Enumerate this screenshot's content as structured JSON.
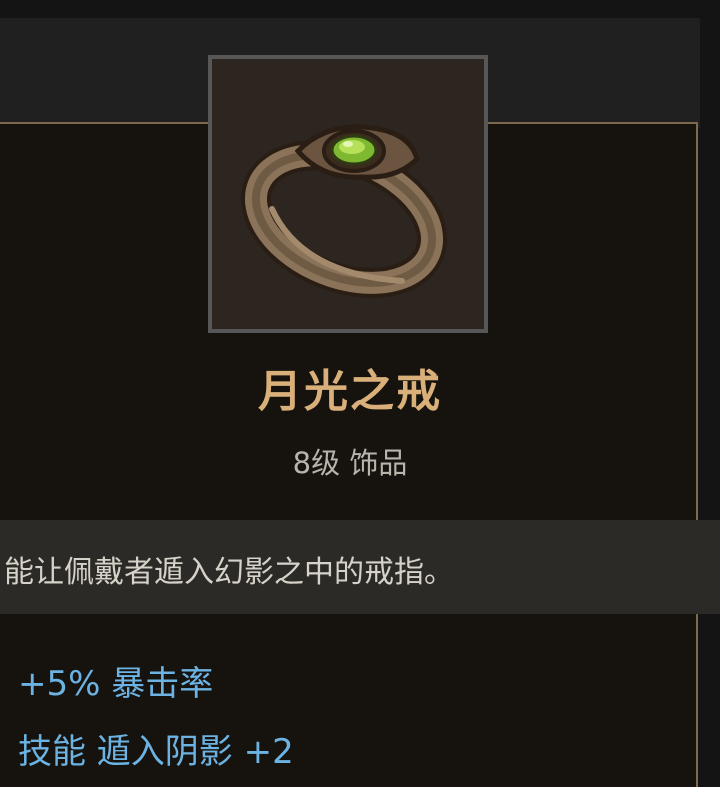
{
  "item": {
    "name": "月光之戒",
    "meta": "8级 饰品",
    "icon": "ring-icon",
    "description": "能让佩戴者遁入幻影之中的戒指。",
    "stats": [
      "+5% 暴击率",
      "技能 遁入阴影 +2"
    ]
  },
  "colors": {
    "name": "#dab07a",
    "stat": "#6cb3e3",
    "border": "#7d6a4c",
    "gem": "#8cc63f"
  }
}
